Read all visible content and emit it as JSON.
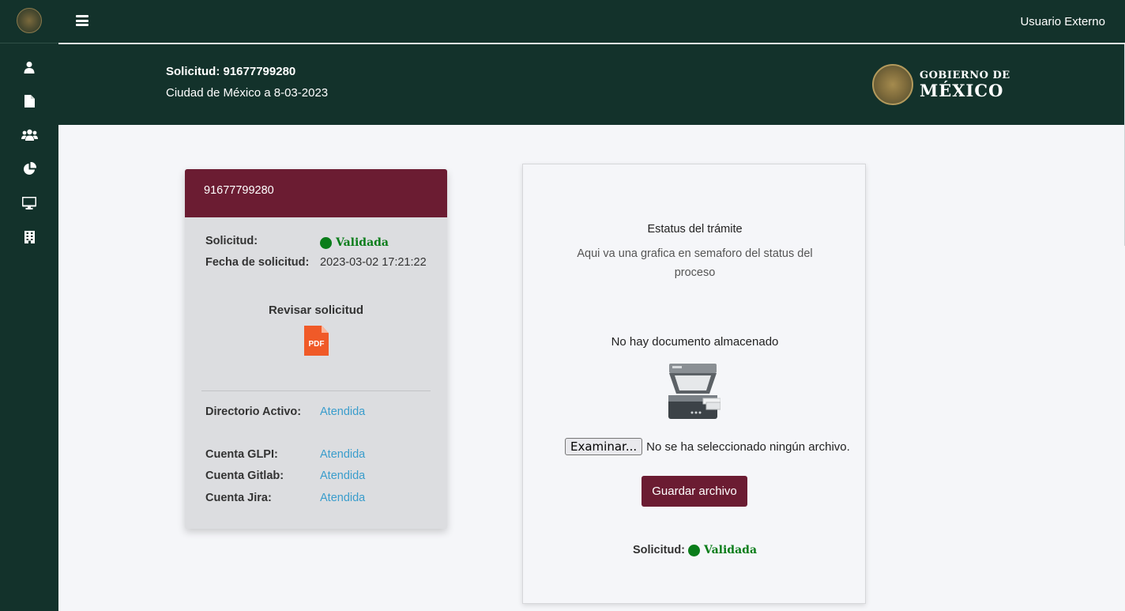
{
  "topbar": {
    "user_label": "Usuario Externo"
  },
  "header": {
    "request_title": "Solicitud: 91677799280",
    "location_date": "Ciudad de México a 8-03-2023",
    "gov_logo_line1": "GOBIERNO DE",
    "gov_logo_line2": "MÉXICO"
  },
  "sidebar": {
    "icons": [
      "user-icon",
      "document-icon",
      "users-icon",
      "pie-chart-icon",
      "monitor-icon",
      "building-icon"
    ]
  },
  "request_card": {
    "id": "91677799280",
    "request_label": "Solicitud:",
    "request_status": "Validada",
    "date_label": "Fecha de solicitud:",
    "date_value": "2023-03-02 17:21:22",
    "review_label": "Revisar solicitud",
    "pdf_label": "PDF",
    "accounts": [
      {
        "label": "Directorio Activo:",
        "value": "Atendida"
      },
      {
        "label": "Cuenta GLPI:",
        "value": "Atendida"
      },
      {
        "label": "Cuenta Gitlab:",
        "value": "Atendida"
      },
      {
        "label": "Cuenta Jira:",
        "value": "Atendida"
      }
    ]
  },
  "status_card": {
    "title": "Estatus del trámite",
    "description": "Aqui va una grafica en semaforo del status del proceso",
    "no_document": "No hay documento almacenado",
    "browse_button": "Examinar...",
    "no_file_text": "No se ha seleccionado ningún archivo.",
    "save_button": "Guardar archivo",
    "request_label": "Solicitud:",
    "request_status": "Validada"
  },
  "colors": {
    "primary_dark": "#13322b",
    "accent_maroon": "#6b1c32",
    "status_green": "#0a7d1a",
    "link_blue": "#3a9dcc"
  }
}
